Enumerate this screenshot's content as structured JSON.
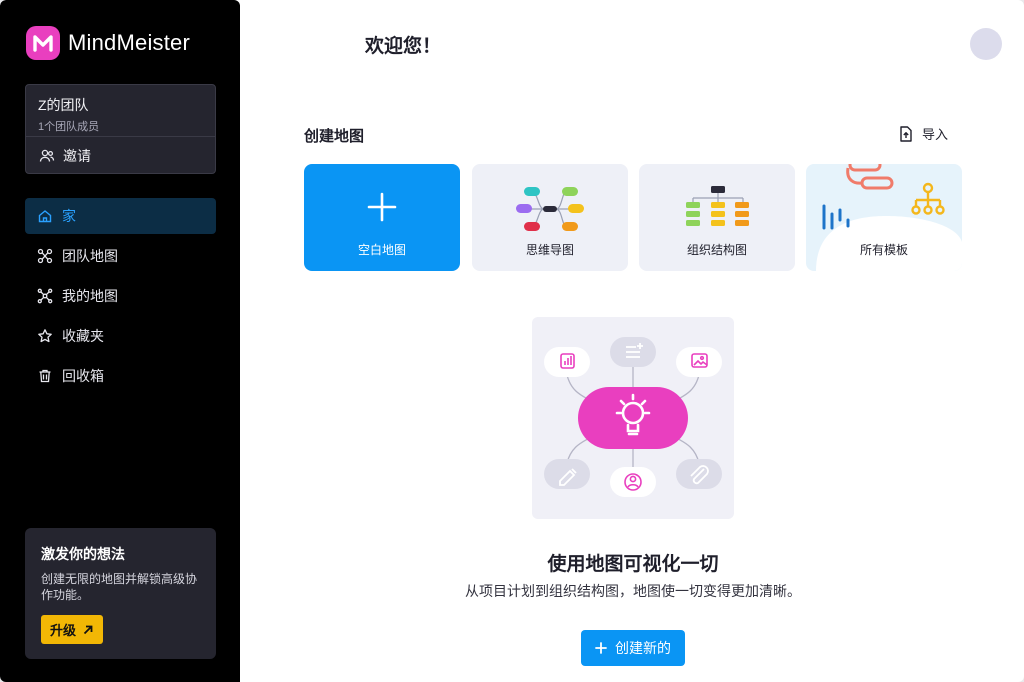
{
  "app": {
    "brand": "MindMeister"
  },
  "team": {
    "name": "Z的团队",
    "members": "1个团队成员",
    "invite_label": "邀请"
  },
  "nav": {
    "items": [
      {
        "label": "家",
        "icon": "home-icon",
        "active": true
      },
      {
        "label": "团队地图",
        "icon": "team-maps-icon",
        "active": false
      },
      {
        "label": "我的地图",
        "icon": "my-maps-icon",
        "active": false
      },
      {
        "label": "收藏夹",
        "icon": "star-icon",
        "active": false
      },
      {
        "label": "回收箱",
        "icon": "trash-icon",
        "active": false
      }
    ]
  },
  "upgrade": {
    "title": "激发你的想法",
    "desc": "创建无限的地图并解锁高级协作功能。",
    "button": "升级"
  },
  "header": {
    "welcome": "欢迎您！"
  },
  "create": {
    "title": "创建地图",
    "import_label": "导入",
    "cards": [
      {
        "label": "空白地图"
      },
      {
        "label": "思维导图"
      },
      {
        "label": "组织结构图"
      },
      {
        "label": "所有模板"
      }
    ]
  },
  "empty_state": {
    "title": "使用地图可视化一切",
    "desc": "从项目计划到组织结构图，地图使一切变得更加清晰。",
    "button": "创建新的"
  },
  "colors": {
    "accent": "#0a95f4",
    "brand": "#e93fbf",
    "upgrade": "#f2b705",
    "sidebar": "#000000"
  }
}
